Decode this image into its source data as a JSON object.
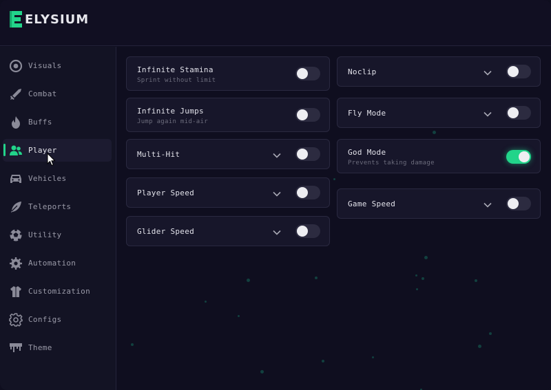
{
  "app": {
    "name": "ELYSIUM",
    "accent_color": "#22d48a"
  },
  "sidebar": {
    "items": [
      {
        "label": "Visuals",
        "icon": "eye-icon",
        "active": false
      },
      {
        "label": "Combat",
        "icon": "sword-icon",
        "active": false
      },
      {
        "label": "Buffs",
        "icon": "flame-icon",
        "active": false
      },
      {
        "label": "Player",
        "icon": "users-icon",
        "active": true
      },
      {
        "label": "Vehicles",
        "icon": "car-icon",
        "active": false
      },
      {
        "label": "Teleports",
        "icon": "feather-icon",
        "active": false
      },
      {
        "label": "Utility",
        "icon": "ball-icon",
        "active": false
      },
      {
        "label": "Automation",
        "icon": "gear-spiked-icon",
        "active": false
      },
      {
        "label": "Customization",
        "icon": "shirt-icon",
        "active": false
      },
      {
        "label": "Configs",
        "icon": "settings-icon",
        "active": false
      },
      {
        "label": "Theme",
        "icon": "paint-drip-icon",
        "active": false
      }
    ]
  },
  "features": {
    "left": [
      {
        "title": "Infinite Stamina",
        "subtitle": "Sprint without limit",
        "enabled": false,
        "has_dropdown": false
      },
      {
        "title": "Infinite Jumps",
        "subtitle": "Jump again mid-air",
        "enabled": false,
        "has_dropdown": false
      },
      {
        "title": "Multi-Hit",
        "subtitle": "",
        "enabled": false,
        "has_dropdown": true
      },
      {
        "title": "Player Speed",
        "subtitle": "",
        "enabled": false,
        "has_dropdown": true
      },
      {
        "title": "Glider Speed",
        "subtitle": "",
        "enabled": false,
        "has_dropdown": true
      }
    ],
    "right": [
      {
        "title": "Noclip",
        "subtitle": "",
        "enabled": false,
        "has_dropdown": true
      },
      {
        "title": "Fly Mode",
        "subtitle": "",
        "enabled": false,
        "has_dropdown": true
      },
      {
        "title": "God Mode",
        "subtitle": "Prevents taking damage",
        "enabled": true,
        "has_dropdown": false
      },
      {
        "title": "Game Speed",
        "subtitle": "",
        "enabled": false,
        "has_dropdown": true
      }
    ]
  }
}
